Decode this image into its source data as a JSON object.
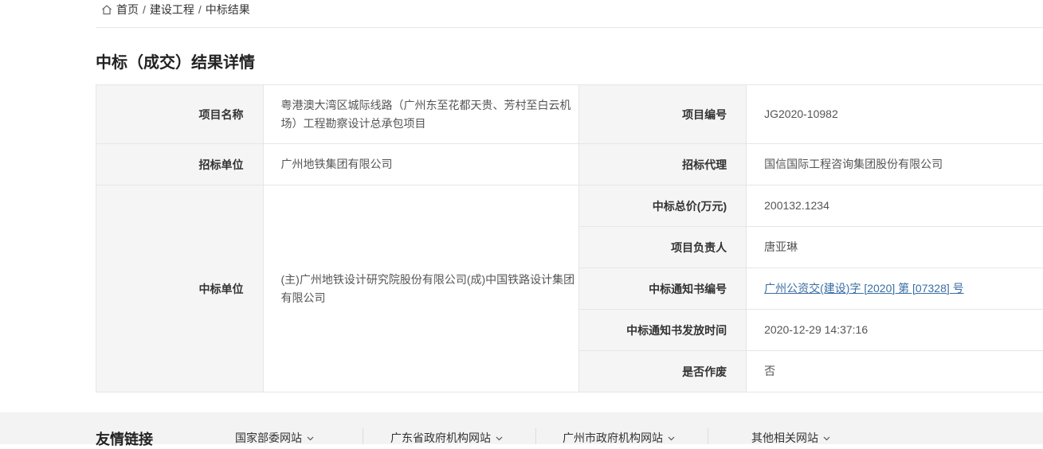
{
  "breadcrumb": {
    "home": "首页",
    "sep": "/",
    "category": "建设工程",
    "current": "中标结果"
  },
  "page_title": "中标（成交）结果详情",
  "details": {
    "project_name": {
      "label": "项目名称",
      "value": "粤港澳大湾区城际线路（广州东至花都天贵、芳村至白云机场）工程勘察设计总承包项目"
    },
    "project_no": {
      "label": "项目编号",
      "value": "JG2020-10982"
    },
    "tenderer": {
      "label": "招标单位",
      "value": "广州地铁集团有限公司"
    },
    "agent": {
      "label": "招标代理",
      "value": "国信国际工程咨询集团股份有限公司"
    },
    "winner": {
      "label": "中标单位",
      "value": "(主)广州地铁设计研究院股份有限公司(成)中国铁路设计集团有限公司"
    },
    "price": {
      "label": "中标总价(万元)",
      "value": "200132.1234"
    },
    "manager": {
      "label": "项目负责人",
      "value": "唐亚琳"
    },
    "notice_no": {
      "label": "中标通知书编号",
      "value": "广州公资交(建设)字 [2020] 第 [07328] 号"
    },
    "notice_time": {
      "label": "中标通知书发放时间",
      "value": "2020-12-29 14:37:16"
    },
    "void": {
      "label": "是否作废",
      "value": "否"
    }
  },
  "footer": {
    "title": "友情链接",
    "links": [
      "国家部委网站",
      "广东省政府机构网站",
      "广州市政府机构网站",
      "其他相关网站"
    ]
  },
  "colors": {
    "label_bg": "#f5f5f5",
    "border": "#e6e6e6",
    "link": "#3a6ea5",
    "footer_bg": "#f3f3f3"
  }
}
